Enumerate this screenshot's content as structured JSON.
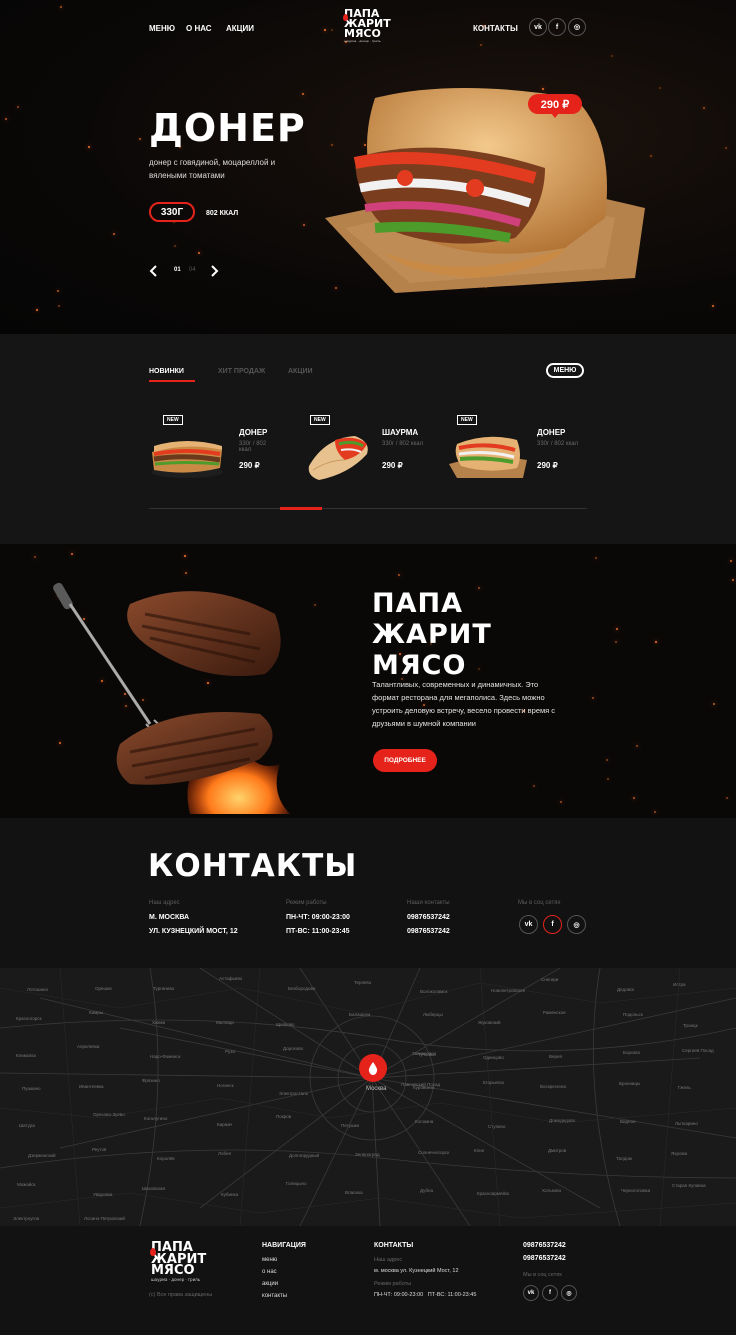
{
  "header": {
    "nav": [
      "меню",
      "о нас",
      "акции"
    ],
    "contacts_link": "КОНТАКТЫ",
    "logo_lines": [
      "ПАПА",
      "ЖАРИТ",
      "МЯСО"
    ],
    "logo_tagline": "шаурма · донер · гриль",
    "social": [
      "vk-icon",
      "facebook-icon",
      "instagram-icon"
    ],
    "social_glyphs": [
      "vk",
      "f",
      "◎"
    ]
  },
  "hero": {
    "title": "ДОНЕР",
    "description": "донер с говядиной, моцареллой и вялеными томатами",
    "weight": "330Г",
    "kcal": "802 ККАЛ",
    "price": "290 ₽",
    "slide_current": "01",
    "slide_total": "04",
    "prev_icon": "chevron-left-icon",
    "next_icon": "chevron-right-icon"
  },
  "tabs": {
    "items": [
      "НОВИНКИ",
      "ХИТ ПРОДАЖ",
      "АКЦИИ"
    ],
    "active": "НОВИНКИ",
    "menu_button": "МЕНЮ"
  },
  "cards": [
    {
      "badge": "NEW",
      "title": "ДОНЕР",
      "meta": "330г / 802 ккал",
      "price": "290 ₽",
      "kind": "doner"
    },
    {
      "badge": "NEW",
      "title": "ШАУРМА",
      "meta": "330г / 802 ккал",
      "price": "290 ₽",
      "kind": "shawarma"
    },
    {
      "badge": "NEW",
      "title": "ДОНЕР",
      "meta": "330г / 802 ккал",
      "price": "290 ₽",
      "kind": "doner"
    }
  ],
  "carousel": {
    "position": 0.33
  },
  "about": {
    "title_lines": [
      "ПАПА",
      "ЖАРИТ",
      "МЯСО"
    ],
    "text": "Талантливых, современных и динамичных. Это формат ресторана для мегаполиса. Здесь можно устроить деловую встречу, весело провести время с друзьями в шумной компании",
    "button": "ПОДРОБНЕЕ"
  },
  "contacts": {
    "title": "КОНТАКТЫ",
    "address_label": "Наш адрес",
    "address_city": "М. МОСКВА",
    "address_street": "УЛ. КУЗНЕЦКИЙ МОСТ, 12",
    "hours_label": "Режим работы",
    "hours_1": "ПН-ЧТ: 09:00-23:00",
    "hours_2": "ПТ-ВС: 11:00-23:45",
    "phones_label": "Наши контакты",
    "phone_1": "09876537242",
    "phone_2": "09876537242",
    "social_label": "Мы в соц сетях",
    "accent": "#e5231b"
  },
  "map": {
    "center_label": "Москва",
    "pin_icon": "map-pin-icon",
    "towns": [
      "Лотошино",
      "Орешки",
      "Тургинево",
      "Астафьево",
      "Безбородово",
      "Теряево",
      "Волоколамск",
      "Новопетровское",
      "Снегири",
      "Дедовск",
      "Истра",
      "Красногорск",
      "Кимры",
      "Химки",
      "Мытищи",
      "Щелково",
      "Балашиха",
      "Люберцы",
      "Жуковский",
      "Раменское",
      "Подольск",
      "Троицк",
      "Климовск",
      "Апрелевка",
      "Наро-Фоминск",
      "Руза",
      "Дорохово",
      "Тучково",
      "Звенигород",
      "Одинцово",
      "Верея",
      "Боровск",
      "Сергиев Посад",
      "Пушкино",
      "Ивантеевка",
      "Фрязино",
      "Ногинск",
      "Электросталь",
      "Павловский Посад",
      "Куровское",
      "Егорьевск",
      "Воскресенск",
      "Бронницы",
      "Гжель",
      "Шатура",
      "Орехово-Зуево",
      "Кольчугино",
      "Киржач",
      "Покров",
      "Петушки",
      "Коломна",
      "Ступино",
      "Домодедово",
      "Видное",
      "Лыткарино",
      "Дзержинский",
      "Реутов",
      "Королёв",
      "Лобня",
      "Долгопрудный",
      "Зеленоград",
      "Солнечногорск",
      "Клин",
      "Дмитров",
      "Талдом",
      "Яхрома",
      "Можайск",
      "Уваровка",
      "Шаховская",
      "Кубинка",
      "Голицыно",
      "Власиха",
      "Дубна",
      "Красноармейск",
      "Хотьково",
      "Черноголовка",
      "Старая Купавна",
      "Электроугли",
      "Лосино-Петровский"
    ]
  },
  "footer": {
    "logo_lines": [
      "ПАПА",
      "ЖАРИТ",
      "МЯСО"
    ],
    "logo_tagline": "шаурма · донер · гриль",
    "copyright": "(с) Все права защищены",
    "nav_heading": "НАВИГАЦИЯ",
    "nav_items": [
      "меню",
      "о нас",
      "акции",
      "контакты"
    ],
    "contacts_heading": "КОНТАКТЫ",
    "address_label": "Наш адрес",
    "address": "м. москва ул. Кузнецкий Мост, 12",
    "hours_label": "Режим работы",
    "hours": "ПН-ЧТ: 09:00-23:00   ПТ-ВС: 11:00-23:45",
    "phone_1": "09876537242",
    "phone_2": "09876537242",
    "social_label": "Мы в соц сетях"
  }
}
